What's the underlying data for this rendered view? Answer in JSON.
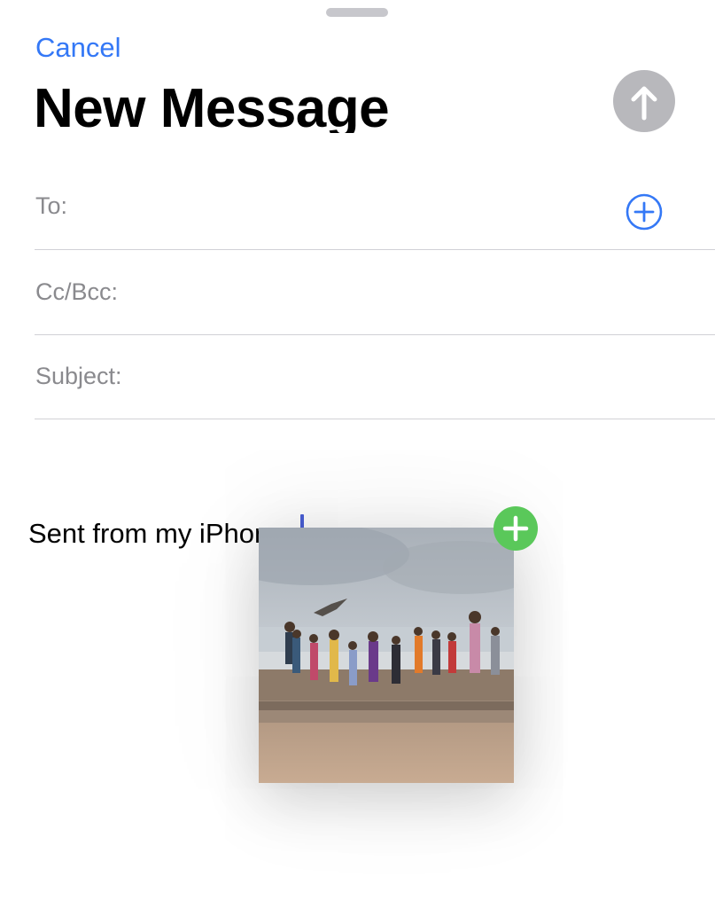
{
  "header": {
    "cancel_label": "Cancel",
    "title": "New Message",
    "send_icon": "arrow-up-icon"
  },
  "fields": {
    "to_label": "To:",
    "cc_bcc_label": "Cc/Bcc:",
    "subject_label": "Subject:",
    "add_contact_icon": "plus-circle-icon"
  },
  "body": {
    "signature": "Sent from my iPhone"
  },
  "drag_item": {
    "kind": "photo",
    "description_icon": "photo-thumbnail",
    "badge_icon": "plus-icon"
  },
  "colors": {
    "accent": "#3478f6",
    "send_disabled": "#b8b8bc",
    "add_badge": "#5ac85a",
    "separator": "#d1d1d6",
    "label_gray": "#8a8a8e",
    "cursor": "#4a5fd6"
  }
}
